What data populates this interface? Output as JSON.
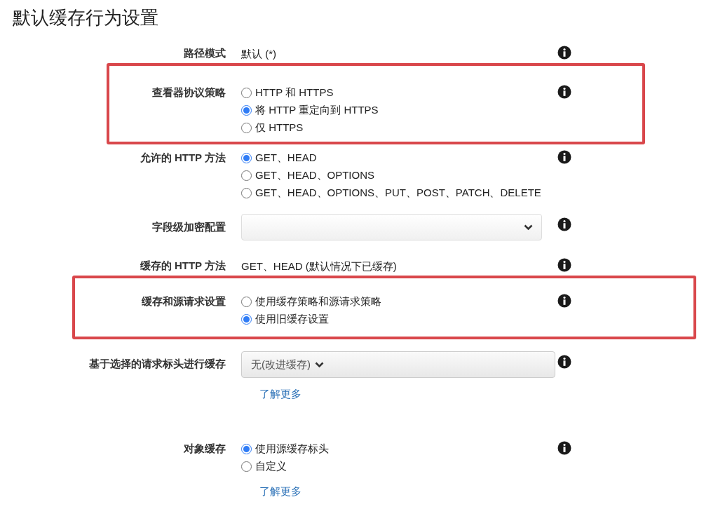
{
  "title": "默认缓存行为设置",
  "rows": [
    {
      "kind": "text",
      "label": "路径模式",
      "value": "默认 (*)"
    },
    {
      "kind": "radio",
      "label": "查看器协议策略",
      "options": [
        {
          "label": "HTTP 和 HTTPS",
          "selected": false
        },
        {
          "label": "将 HTTP 重定向到 HTTPS",
          "selected": true
        },
        {
          "label": "仅 HTTPS",
          "selected": false
        }
      ]
    },
    {
      "kind": "radio",
      "label": "允许的 HTTP 方法",
      "options": [
        {
          "label": "GET、HEAD",
          "selected": true
        },
        {
          "label": "GET、HEAD、OPTIONS",
          "selected": false
        },
        {
          "label": "GET、HEAD、OPTIONS、PUT、POST、PATCH、DELETE",
          "selected": false
        }
      ]
    },
    {
      "kind": "select",
      "label": "字段级加密配置"
    },
    {
      "kind": "text",
      "label": "缓存的 HTTP 方法",
      "value": "GET、HEAD (默认情况下已缓存)"
    },
    {
      "kind": "radio",
      "label": "缓存和源请求设置",
      "options": [
        {
          "label": "使用缓存策略和源请求策略",
          "selected": false
        },
        {
          "label": "使用旧缓存设置",
          "selected": true
        }
      ]
    },
    {
      "kind": "dropdown",
      "label": "基于选择的请求标头进行缓存",
      "value": "无(改进缓存)",
      "link": "了解更多"
    },
    {
      "kind": "radio",
      "label": "对象缓存",
      "options": [
        {
          "label": "使用源缓存标头",
          "selected": true
        },
        {
          "label": "自定义",
          "selected": false
        }
      ],
      "link": "了解更多"
    }
  ]
}
